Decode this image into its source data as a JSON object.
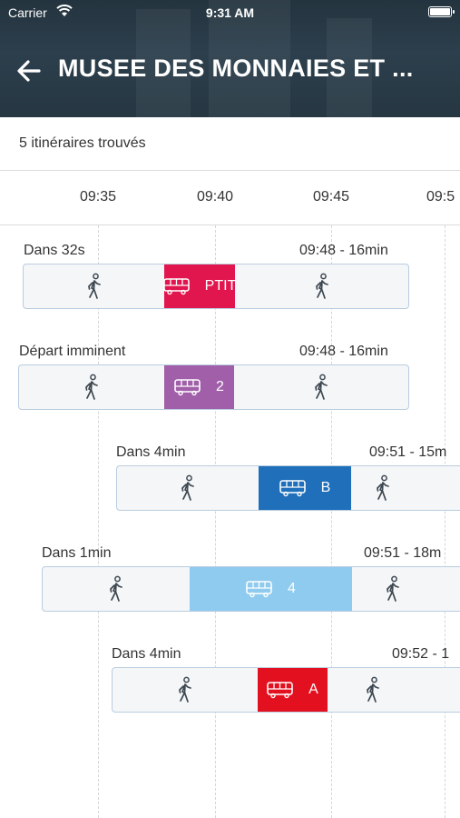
{
  "status_bar": {
    "carrier": "Carrier",
    "time": "9:31 AM"
  },
  "header": {
    "title": "MUSEE DES MONNAIES ET ..."
  },
  "results": {
    "count_text": "5 itinéraires trouvés"
  },
  "timeline": {
    "ticks": [
      "09:35",
      "09:40",
      "09:45",
      "09:5"
    ]
  },
  "routes": [
    {
      "departure": "Dans 32s",
      "arrival": "09:48 - 16min",
      "line": "PTIT",
      "line_color": "#e2164f"
    },
    {
      "departure": "Départ imminent",
      "arrival": "09:48 - 16min",
      "line": "2",
      "line_color": "#a05fa8"
    },
    {
      "departure": "Dans 4min",
      "arrival": "09:51 - 15m",
      "line": "B",
      "line_color": "#1f6fba"
    },
    {
      "departure": "Dans 1min",
      "arrival": "09:51 - 18m",
      "line": "4",
      "line_color": "#8fcbee"
    },
    {
      "departure": "Dans 4min",
      "arrival": "09:52 - 1",
      "line": "A",
      "line_color": "#e3111f"
    }
  ]
}
